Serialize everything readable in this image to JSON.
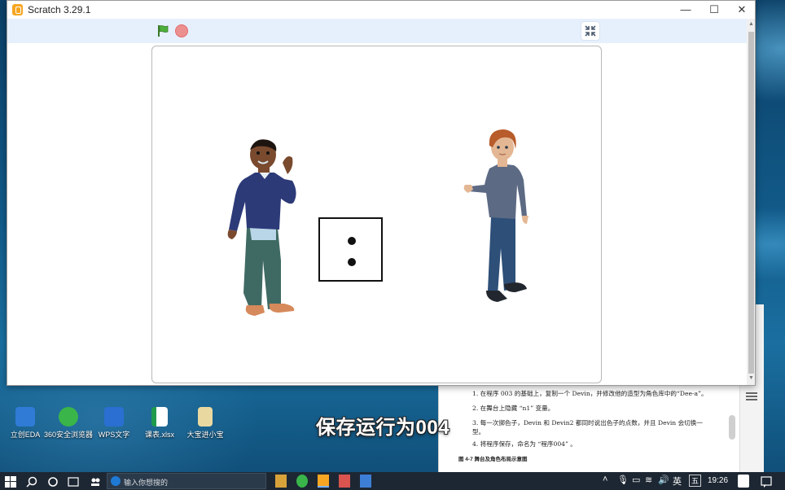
{
  "window": {
    "title": "Scratch 3.29.1",
    "controls": {
      "minimize": "—",
      "maximize": "☐",
      "close": "✕"
    }
  },
  "stage_header": {
    "icons": [
      "green-flag-icon",
      "stop-icon",
      "exit-fullscreen-icon"
    ]
  },
  "desktop": {
    "icons": [
      {
        "label": "立创EDA",
        "color": "#2f7bd6"
      },
      {
        "label": "360安全浏览器",
        "color": "#3ab54a"
      },
      {
        "label": "WPS文字",
        "color": "#2a6fd1"
      },
      {
        "label": "课表.xlsx",
        "color": "#1f9a4c"
      },
      {
        "label": "大宝进小宝",
        "color": "#e9d9a1"
      }
    ]
  },
  "subtitle": "保存运行为004",
  "document": {
    "lines": [
      "1. 在程序 003 的基础上，复制一个 Devin，并修改他的造型为角色库中的“Dee-a”。",
      "2. 在舞台上隐藏 “n1” 变量。",
      "3. 每一次掷色子，Devin 和 Devin2 都同时说出色子的点数，并且 Devin 会切换一",
      "   型。",
      "4. 将程序保存，命名为 “程序004” 。"
    ],
    "caption": "图 4-7  舞台及角色布局示意图"
  },
  "taskbar": {
    "search_placeholder": "输入你想搜的",
    "tray_lang": "英",
    "tray_ime": "五",
    "clock": "19:26"
  }
}
